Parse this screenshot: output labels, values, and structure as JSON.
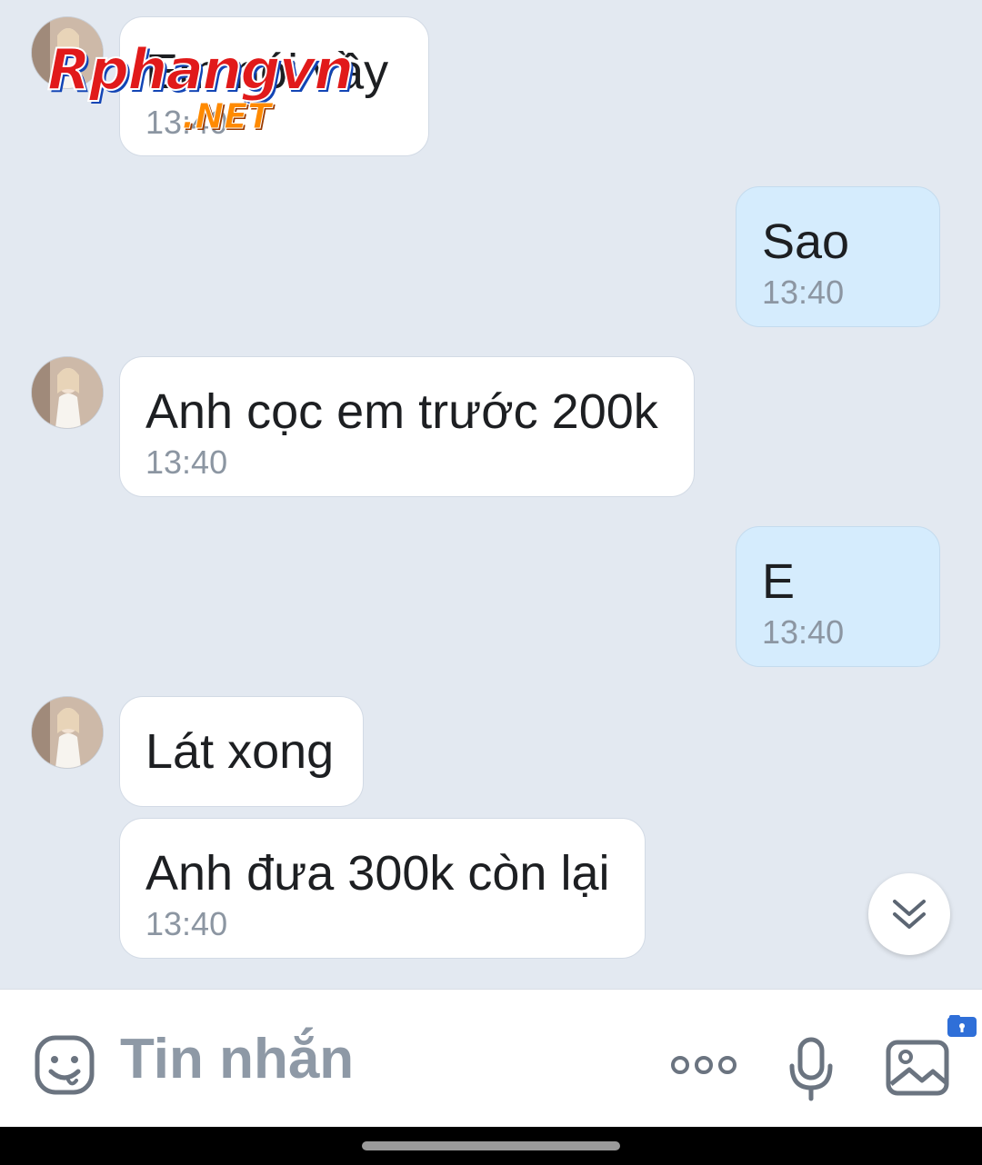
{
  "watermark": {
    "line1": "Rphangvn",
    "line2": ".NET"
  },
  "messages": [
    {
      "direction": "in",
      "text": "Em nói vầy",
      "time": "13:40"
    },
    {
      "direction": "out",
      "text": "Sao",
      "time": "13:40"
    },
    {
      "direction": "in",
      "text": "Anh cọc em trước 200k",
      "time": "13:40"
    },
    {
      "direction": "out",
      "text": "E",
      "time": "13:40"
    },
    {
      "direction": "in",
      "text": "Lát xong",
      "time": ""
    },
    {
      "direction": "in",
      "text": "Anh đưa 300k còn lại",
      "time": "13:40"
    }
  ],
  "composer": {
    "placeholder": "Tin nhắn",
    "icons": [
      "sticker-icon",
      "more-icon",
      "microphone-icon",
      "gallery-icon"
    ]
  },
  "colors": {
    "chat_background": "#e3e9f1",
    "incoming_bubble": "#ffffff",
    "outgoing_bubble": "#d5ecfd",
    "timestamp": "#8c96a2",
    "accent": "#2f6fd8"
  }
}
